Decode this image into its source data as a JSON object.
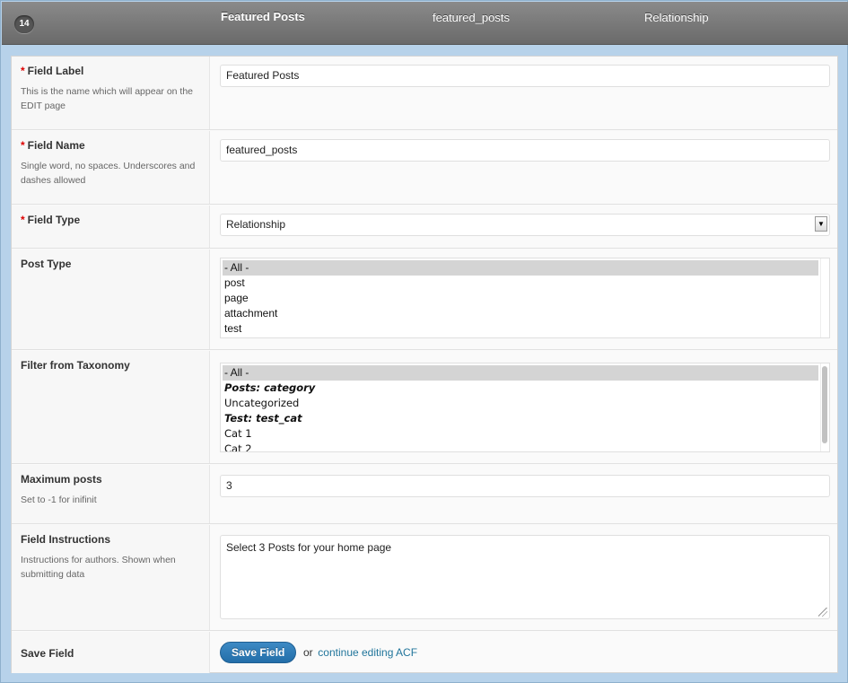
{
  "header": {
    "order_number": "14",
    "label": "Featured Posts",
    "name": "featured_posts",
    "type": "Relationship"
  },
  "fields": {
    "field_label": {
      "title": "Field Label",
      "required_mark": "*",
      "description": "This is the name which will appear on the EDIT page",
      "value": "Featured Posts"
    },
    "field_name": {
      "title": "Field Name",
      "required_mark": "*",
      "description": "Single word, no spaces. Underscores and dashes allowed",
      "value": "featured_posts"
    },
    "field_type": {
      "title": "Field Type",
      "required_mark": "*",
      "value": "Relationship"
    },
    "post_type": {
      "title": "Post Type",
      "options": [
        "- All -",
        "post",
        "page",
        "attachment",
        "test"
      ],
      "selected": "- All -"
    },
    "filter_taxonomy": {
      "title": "Filter from Taxonomy",
      "options": [
        "- All -",
        "Posts: category",
        "Uncategorized",
        "Test: test_cat",
        "Cat 1",
        "Cat 2"
      ],
      "selected": "- All -"
    },
    "maximum_posts": {
      "title": "Maximum posts",
      "description": "Set to -1 for inifinit",
      "value": "3"
    },
    "field_instructions": {
      "title": "Field Instructions",
      "description": "Instructions for authors. Shown when submitting data",
      "value": "Select 3 Posts for your home page"
    },
    "save_field": {
      "title": "Save Field",
      "button_label": "Save Field",
      "or_text": "or",
      "link_text": "continue editing ACF"
    }
  },
  "colors": {
    "header_bg": "#777777",
    "accent_button": "#2a7ab8",
    "link": "#21759b",
    "required": "#dd0000"
  }
}
